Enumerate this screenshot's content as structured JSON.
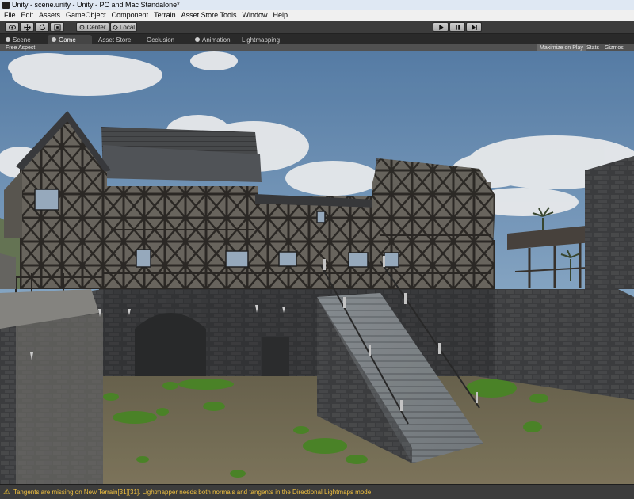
{
  "window": {
    "title": "Unity - scene.unity - Unity - PC and Mac Standalone*"
  },
  "menu": {
    "items": [
      {
        "label": "File"
      },
      {
        "label": "Edit"
      },
      {
        "label": "Assets"
      },
      {
        "label": "GameObject"
      },
      {
        "label": "Component"
      },
      {
        "label": "Terrain"
      },
      {
        "label": "Asset Store Tools"
      },
      {
        "label": "Window"
      },
      {
        "label": "Help"
      }
    ]
  },
  "toolbar": {
    "tools": [
      {
        "icon": "eye-icon"
      },
      {
        "icon": "move-icon"
      },
      {
        "icon": "rotate-icon"
      },
      {
        "icon": "scale-icon"
      }
    ],
    "pivot_label": "Center",
    "space_label": "Local",
    "play_icon": "play-icon",
    "pause_icon": "pause-icon",
    "step_icon": "step-icon"
  },
  "tabs": [
    {
      "label": "Scene",
      "icon": "scene-icon"
    },
    {
      "label": "Game",
      "icon": "game-icon",
      "active": true
    },
    {
      "label": "Asset Store",
      "icon": ""
    },
    {
      "label": "Occlusion",
      "icon": ""
    },
    {
      "label": "Animation",
      "icon": "animation-icon"
    },
    {
      "label": "Lightmapping",
      "icon": ""
    }
  ],
  "game_view": {
    "aspect": "Free Aspect",
    "maximize_on_play": "Maximize on Play",
    "stats": "Stats",
    "gizmos": "Gizmos"
  },
  "status": {
    "icon": "warning-icon",
    "message": "Tangents are missing on New Terrain[31][31]. Lightmapper needs both normals and tangents in the Directional Lightmaps mode."
  },
  "colors": {
    "editor_dark": "#3c3c3c",
    "status_text": "#f0c040",
    "sky": "#6f93b8"
  }
}
